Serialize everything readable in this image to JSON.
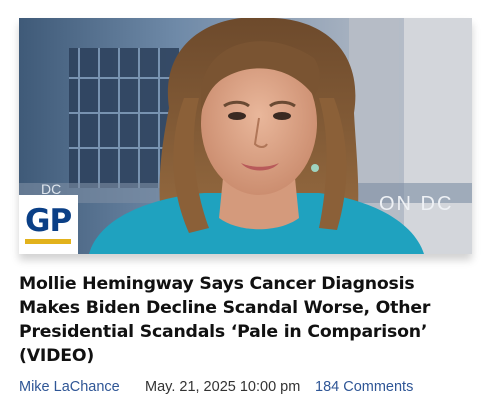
{
  "article": {
    "headline": "Mollie Hemingway Says Cancer Diagnosis Makes Biden Decline Scandal Worse, Other Presidential Scandals ‘Pale in Comparison’ (VIDEO)",
    "author": "Mike LaChance",
    "date": "May. 21, 2025 10:00 pm",
    "comments": "184 Comments"
  },
  "image": {
    "background_text": "ON DC",
    "background_text_left": "DC"
  },
  "logo": {
    "text": "GP"
  },
  "colors": {
    "link": "#2f5696",
    "logo_blue": "#0a3f86",
    "logo_gold": "#e2b21c",
    "headline": "#111111"
  }
}
